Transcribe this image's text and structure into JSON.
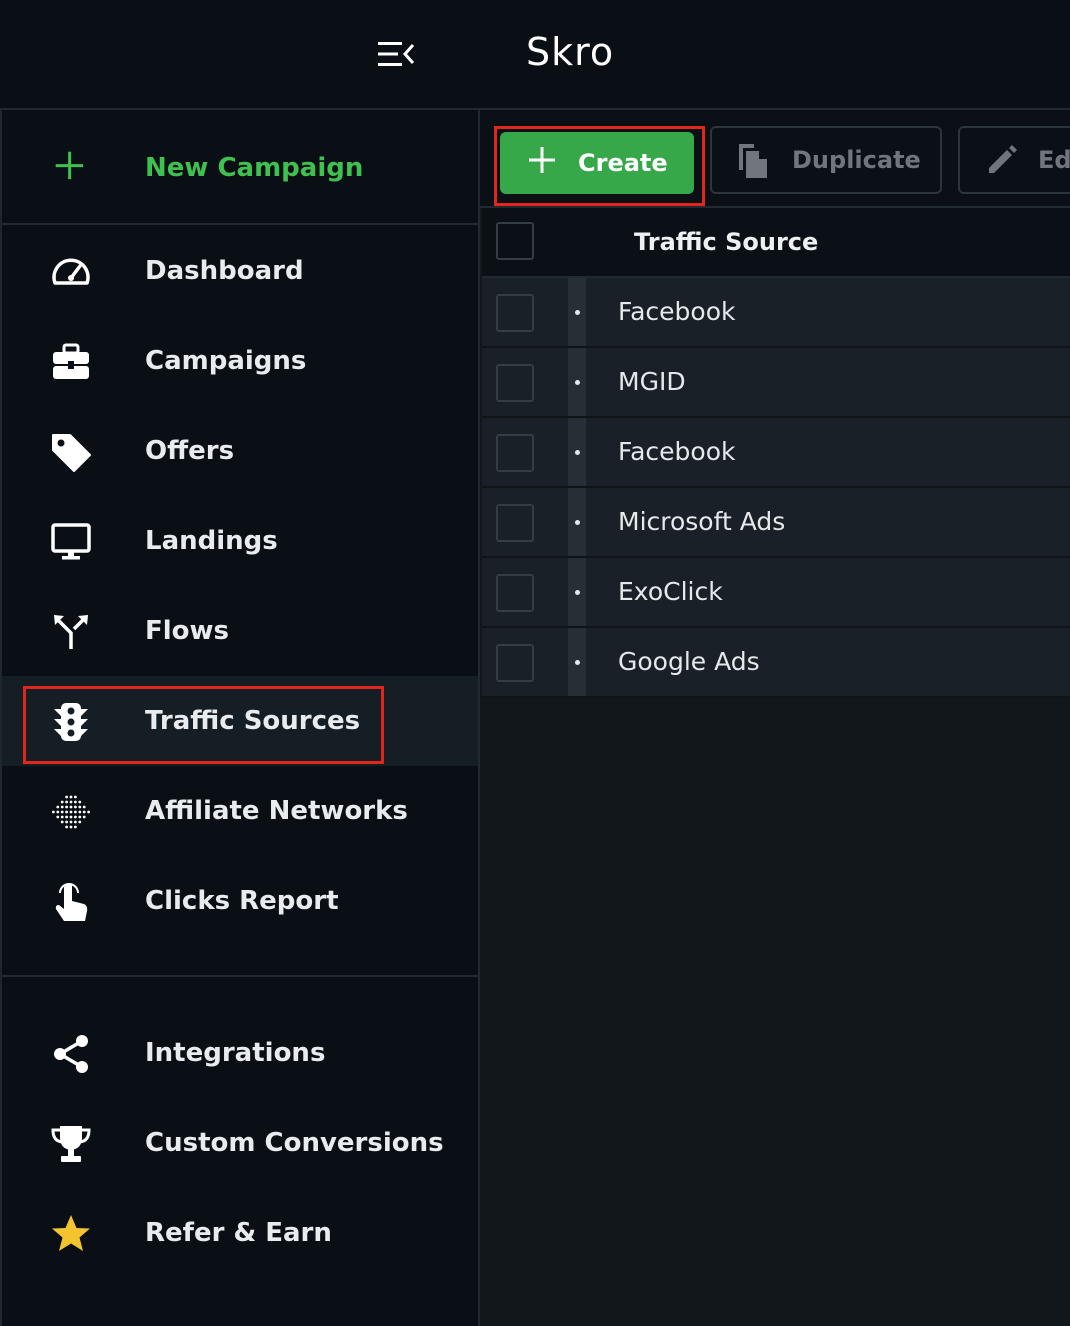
{
  "app": {
    "brand": "Skro"
  },
  "sidebar": {
    "new_campaign": {
      "label": "New Campaign",
      "icon": "plus-icon"
    },
    "items": [
      {
        "label": "Dashboard",
        "icon": "speedometer-icon"
      },
      {
        "label": "Campaigns",
        "icon": "briefcase-icon"
      },
      {
        "label": "Offers",
        "icon": "tag-icon"
      },
      {
        "label": "Landings",
        "icon": "monitor-icon"
      },
      {
        "label": "Flows",
        "icon": "flow-split-icon"
      },
      {
        "label": "Traffic Sources",
        "icon": "traffic-light-icon",
        "active": true
      },
      {
        "label": "Affiliate Networks",
        "icon": "dots-grid-icon"
      },
      {
        "label": "Clicks Report",
        "icon": "pointer-hand-icon"
      }
    ],
    "secondary": [
      {
        "label": "Integrations",
        "icon": "share-icon"
      },
      {
        "label": "Custom Conversions",
        "icon": "trophy-icon"
      },
      {
        "label": "Refer & Earn",
        "icon": "star-icon"
      }
    ]
  },
  "toolbar": {
    "create_label": "Create",
    "duplicate_label": "Duplicate",
    "edit_label": "Ed"
  },
  "table": {
    "column_header": "Traffic Source",
    "rows": [
      "Facebook",
      "MGID",
      "Facebook",
      "Microsoft Ads",
      "ExoClick",
      "Google Ads"
    ]
  },
  "colors": {
    "accent_green": "#3fc14f",
    "create_button": "#36a84a",
    "highlight_red": "#e2261b",
    "star_yellow": "#f4c430"
  }
}
